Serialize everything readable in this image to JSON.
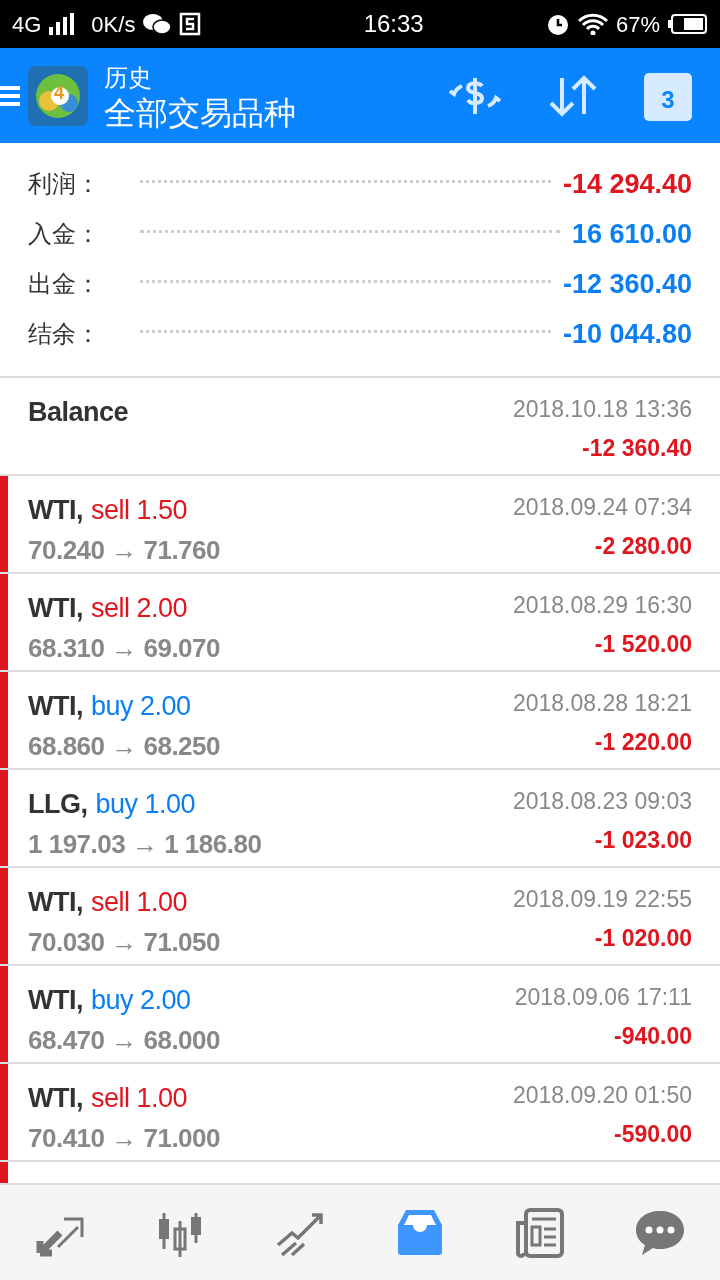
{
  "status_bar": {
    "network": "4G",
    "speed": "0K/s",
    "time": "16:33",
    "battery": "67%"
  },
  "header": {
    "logo_badge": "4",
    "title": "历史",
    "subtitle": "全部交易品种",
    "calendar_day": "3"
  },
  "summary": [
    {
      "label": "利润：",
      "value": "-14 294.40",
      "color": "#e0161e"
    },
    {
      "label": "入金：",
      "value": "16 610.00",
      "color": "#0a7ff5"
    },
    {
      "label": "出金：",
      "value": "-12 360.40",
      "color": "#0a7ff5"
    },
    {
      "label": "结余：",
      "value": "-10 044.80",
      "color": "#0a7ff5"
    }
  ],
  "balance": {
    "label": "Balance",
    "time": "2018.10.18 13:36",
    "amount": "-12 360.40"
  },
  "trades": [
    {
      "symbol": "WTI,",
      "type": "sell",
      "volume": "1.50",
      "open": "70.240",
      "arrow": "→",
      "close": "71.760",
      "time": "2018.09.24 07:34",
      "profit": "-2 280.00"
    },
    {
      "symbol": "WTI,",
      "type": "sell",
      "volume": "2.00",
      "open": "68.310",
      "arrow": "→",
      "close": "69.070",
      "time": "2018.08.29 16:30",
      "profit": "-1 520.00"
    },
    {
      "symbol": "WTI,",
      "type": "buy",
      "volume": "2.00",
      "open": "68.860",
      "arrow": "→",
      "close": "68.250",
      "time": "2018.08.28 18:21",
      "profit": "-1 220.00"
    },
    {
      "symbol": "LLG,",
      "type": "buy",
      "volume": "1.00",
      "open": "1 197.03",
      "arrow": "→",
      "close": "1 186.80",
      "time": "2018.08.23 09:03",
      "profit": "-1 023.00"
    },
    {
      "symbol": "WTI,",
      "type": "sell",
      "volume": "1.00",
      "open": "70.030",
      "arrow": "→",
      "close": "71.050",
      "time": "2018.09.19 22:55",
      "profit": "-1 020.00"
    },
    {
      "symbol": "WTI,",
      "type": "buy",
      "volume": "2.00",
      "open": "68.470",
      "arrow": "→",
      "close": "68.000",
      "time": "2018.09.06 17:11",
      "profit": "-940.00"
    },
    {
      "symbol": "WTI,",
      "type": "sell",
      "volume": "1.00",
      "open": "70.410",
      "arrow": "→",
      "close": "71.000",
      "time": "2018.09.20 01:50",
      "profit": "-590.00"
    }
  ],
  "bottom_nav": [
    {
      "kind": "quotes",
      "selected": false
    },
    {
      "kind": "chart",
      "selected": false
    },
    {
      "kind": "trade",
      "selected": false
    },
    {
      "kind": "history",
      "selected": true
    },
    {
      "kind": "news",
      "selected": false
    },
    {
      "kind": "chat",
      "selected": false
    }
  ]
}
